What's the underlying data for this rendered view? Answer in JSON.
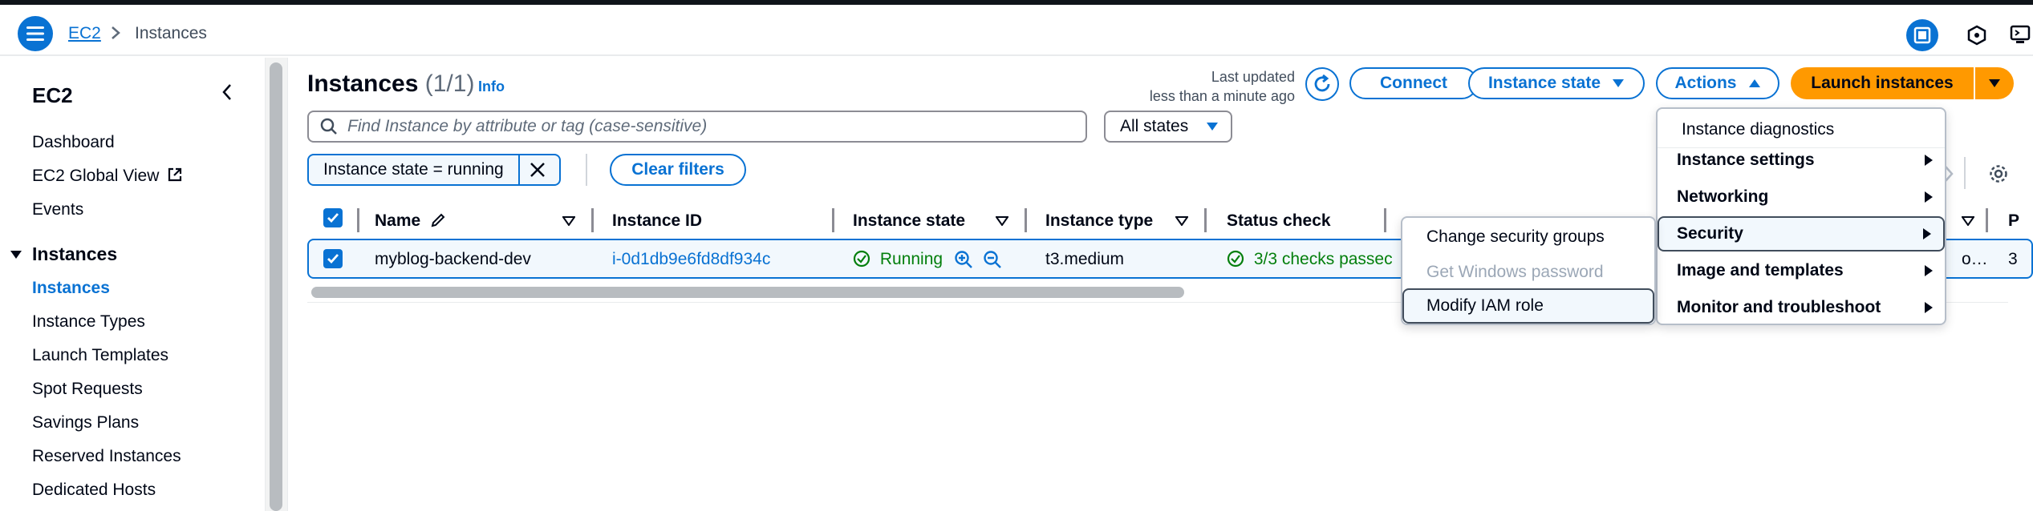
{
  "breadcrumb": {
    "root": "EC2",
    "current": "Instances"
  },
  "sidebar": {
    "title": "EC2",
    "items": [
      {
        "label": "Dashboard"
      },
      {
        "label": "EC2 Global View"
      },
      {
        "label": "Events"
      }
    ],
    "section": "Instances",
    "section_items": [
      {
        "label": "Instances",
        "active": true
      },
      {
        "label": "Instance Types"
      },
      {
        "label": "Launch Templates"
      },
      {
        "label": "Spot Requests"
      },
      {
        "label": "Savings Plans"
      },
      {
        "label": "Reserved Instances"
      },
      {
        "label": "Dedicated Hosts"
      }
    ]
  },
  "header": {
    "title": "Instances",
    "count": "(1/1)",
    "info": "Info",
    "last_updated_line1": "Last updated",
    "last_updated_line2": "less than a minute ago"
  },
  "toolbar": {
    "connect": "Connect",
    "instance_state": "Instance state",
    "actions": "Actions",
    "launch": "Launch instances"
  },
  "search": {
    "placeholder": "Find Instance by attribute or tag (case-sensitive)"
  },
  "states_filter": "All states",
  "filter_token": "Instance state = running",
  "clear_filters": "Clear filters",
  "table": {
    "columns": [
      "Name",
      "Instance ID",
      "Instance state",
      "Instance type",
      "Status check"
    ],
    "rows": [
      {
        "name": "myblog-backend-dev",
        "instance_id": "i-0d1db9e6fd8df934c",
        "state": "Running",
        "type": "t3.medium",
        "status": "3/3 checks passec",
        "trunc": "o…",
        "trunc2": "3"
      }
    ],
    "col_trunc": "P"
  },
  "actions_menu": {
    "items": [
      {
        "label": "Instance diagnostics"
      },
      {
        "label": "Instance settings"
      },
      {
        "label": "Networking"
      },
      {
        "label": "Security"
      },
      {
        "label": "Image and templates"
      },
      {
        "label": "Monitor and troubleshoot"
      }
    ]
  },
  "security_menu": {
    "items": [
      {
        "label": "Change security groups"
      },
      {
        "label": "Get Windows password"
      },
      {
        "label": "Modify IAM role"
      }
    ]
  },
  "colors": {
    "accent": "#0972d3",
    "launch": "#ff9900",
    "success": "#037f0c"
  }
}
